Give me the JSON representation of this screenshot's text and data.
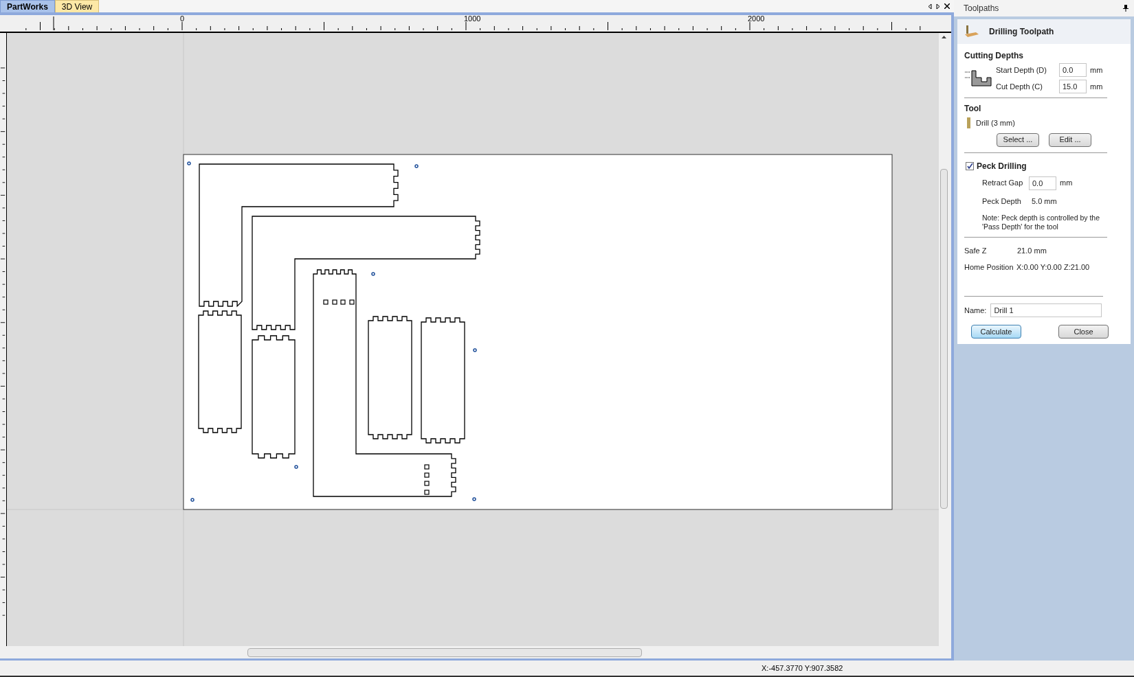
{
  "tabs": [
    {
      "label": "PartWorks",
      "selected": true
    },
    {
      "label": "3D View",
      "selected": false
    }
  ],
  "ruler": {
    "labels": [
      "0",
      "1000",
      "2000"
    ]
  },
  "panel": {
    "title": "Toolpaths",
    "heading": "Drilling Toolpath",
    "cutting_depths": {
      "title": "Cutting Depths",
      "fields": [
        {
          "label": "Start Depth (D)",
          "value": "0.0",
          "unit": "mm"
        },
        {
          "label": "Cut Depth (C)",
          "value": "15.0",
          "unit": "mm"
        }
      ]
    },
    "tool": {
      "title": "Tool",
      "name": "Drill (3 mm)",
      "buttons": [
        "Select ...",
        "Edit ..."
      ]
    },
    "peck": {
      "label": "Peck Drilling",
      "checked": true,
      "retract_label": "Retract Gap",
      "retract_value": "0.0",
      "retract_unit": "mm",
      "depth_label": "Peck Depth",
      "depth_value": "5.0 mm",
      "note": "Note: Peck depth is controlled by the 'Pass Depth' for the tool"
    },
    "info": [
      {
        "label": "Safe Z",
        "value": "21.0 mm"
      },
      {
        "label": "Home Position",
        "value": "X:0.00 Y:0.00 Z:21.00"
      }
    ],
    "name": {
      "label": "Name:",
      "value": "Drill 1"
    },
    "actions": [
      {
        "label": "Calculate",
        "selected": true
      },
      {
        "label": "Close",
        "selected": false
      }
    ]
  },
  "status_bar": {
    "coordinates": "X:-457.3770 Y:907.3582"
  }
}
